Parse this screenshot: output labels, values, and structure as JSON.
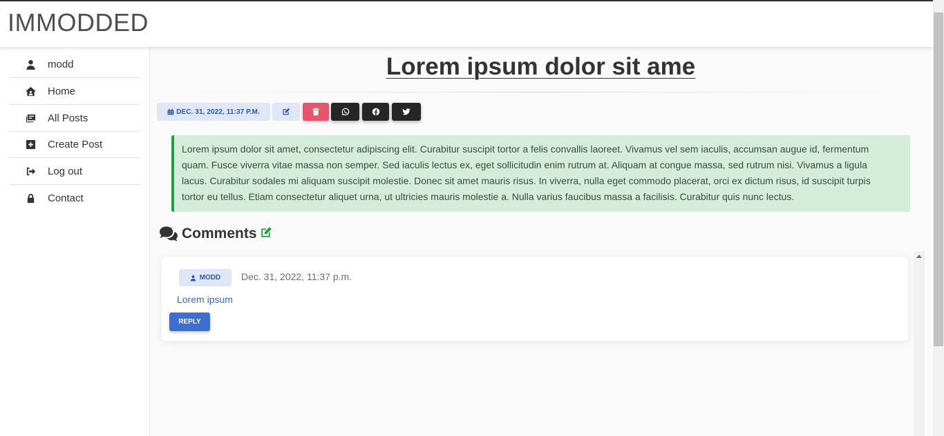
{
  "app": {
    "brand": "IMMODDED"
  },
  "sidebar": {
    "items": [
      {
        "label": "modd",
        "icon": "user-icon"
      },
      {
        "label": "Home",
        "icon": "home-icon"
      },
      {
        "label": "All Posts",
        "icon": "posts-icon"
      },
      {
        "label": "Create Post",
        "icon": "plus-square-icon"
      },
      {
        "label": "Log out",
        "icon": "sign-out-icon"
      },
      {
        "label": "Contact",
        "icon": "lock-icon"
      }
    ]
  },
  "post": {
    "title": "Lorem ipsum dolor sit ame",
    "date": "DEC. 31, 2022, 11:37 P.M.",
    "body": "Lorem ipsum dolor sit amet, consectetur adipiscing elit. Curabitur suscipit tortor a felis convallis laoreet. Vivamus vel sem iaculis, accumsan augue id, fermentum quam. Fusce viverra vitae massa non semper. Sed iaculis lectus ex, eget sollicitudin enim rutrum at. Aliquam at congue massa, sed rutrum nisi. Vivamus a ligula lacus. Curabitur sodales mi aliquam suscipit molestie. Donec sit amet mauris risus. In viverra, nulla eget commodo placerat, orci ex dictum risus, id suscipit turpis tortor eu tellus. Etiam consectetur aliquet urna, ut ultricies mauris molestie a. Nulla varius faucibus massa a facilisis. Curabitur quis nunc lectus.",
    "actions": [
      "edit-icon",
      "trash-icon",
      "whatsapp-icon",
      "facebook-icon",
      "twitter-icon"
    ],
    "colors": {
      "danger": "#e4566b",
      "success": "#1e9e45",
      "primary": "#3b6fd1",
      "dark": "#262626"
    }
  },
  "comments": {
    "heading": "Comments",
    "items": [
      {
        "author": "MODD",
        "date": "Dec. 31, 2022, 11:37 p.m.",
        "text": "Lorem ipsum",
        "reply_label": "REPLY"
      }
    ]
  }
}
